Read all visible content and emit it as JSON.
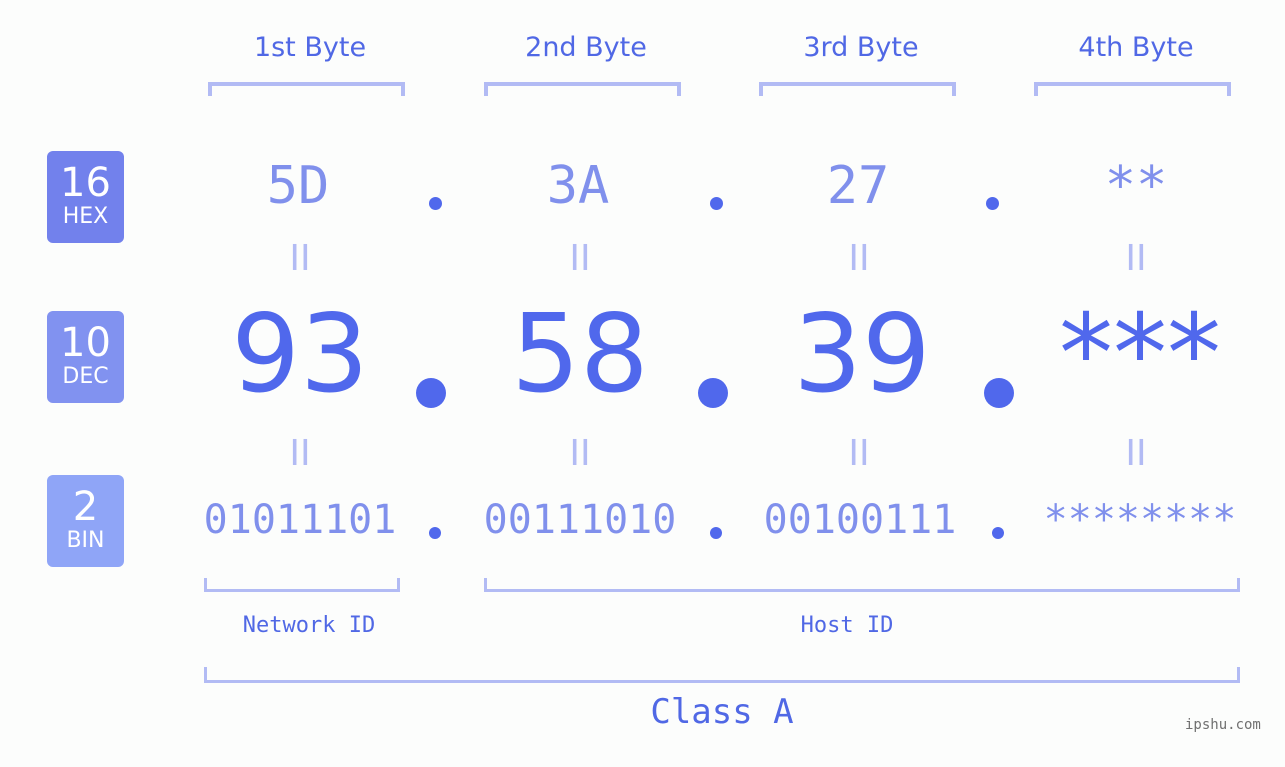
{
  "bytes": [
    {
      "label": "1st Byte",
      "hex": "5D",
      "dec": "93",
      "bin": "01011101"
    },
    {
      "label": "2nd Byte",
      "hex": "3A",
      "dec": "58",
      "bin": "00111010"
    },
    {
      "label": "3rd Byte",
      "hex": "27",
      "dec": "39",
      "bin": "00100111"
    },
    {
      "label": "4th Byte",
      "hex": "**",
      "dec": "***",
      "bin": "********"
    }
  ],
  "rows": {
    "hex": {
      "base": "16",
      "unit": "HEX",
      "color": "#7281ec"
    },
    "dec": {
      "base": "10",
      "unit": "DEC",
      "color": "#8192f0"
    },
    "bin": {
      "base": "2",
      "unit": "BIN",
      "color": "#8fa5f7"
    }
  },
  "equals_symbol": "II",
  "segments": {
    "network": "Network ID",
    "host": "Host ID"
  },
  "ip_class": "Class A",
  "watermark": "ipshu.com",
  "colors": {
    "accent": "#5068e5",
    "light": "#8090ec",
    "bracket": "#b2bbf4"
  }
}
